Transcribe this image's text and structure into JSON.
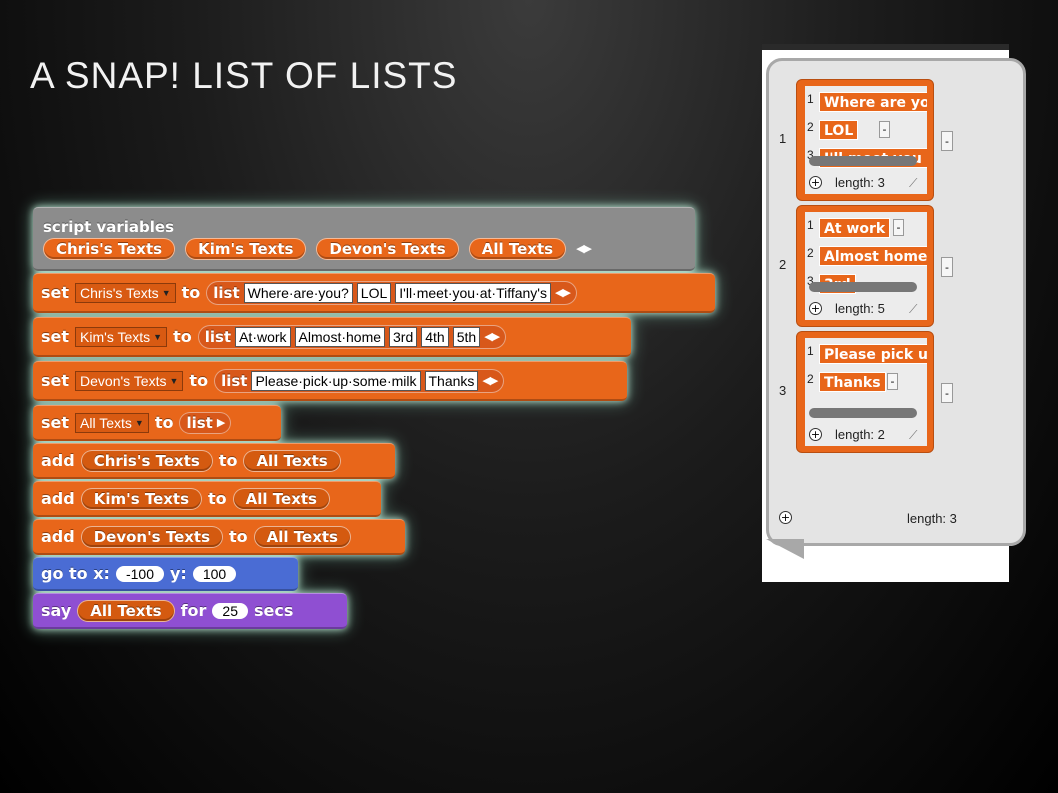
{
  "slide": {
    "title": "A SNAP! LIST OF LISTS"
  },
  "script": {
    "script_variables_label": "script variables",
    "variables": [
      "Chris's Texts",
      "Kim's Texts",
      "Devon's Texts",
      "All Texts"
    ],
    "set_kw": "set",
    "to_kw": "to",
    "list_kw": "list",
    "add_kw": "add",
    "set_blocks": [
      {
        "var": "Chris's Texts",
        "items": [
          "Where·are·you?",
          "LOL",
          "I'll·meet·you·at·Tiffany's"
        ]
      },
      {
        "var": "Kim's Texts",
        "items": [
          "At·work",
          "Almost·home",
          "3rd",
          "4th",
          "5th"
        ]
      },
      {
        "var": "Devon's Texts",
        "items": [
          "Please·pick·up·some·milk",
          "Thanks"
        ]
      },
      {
        "var": "All Texts",
        "items": []
      }
    ],
    "add_blocks": [
      {
        "item": "Chris's Texts",
        "target": "All Texts"
      },
      {
        "item": "Kim's Texts",
        "target": "All Texts"
      },
      {
        "item": "Devon's Texts",
        "target": "All Texts"
      }
    ],
    "goto": {
      "label": "go to x:",
      "x": "-100",
      "y_label": "y:",
      "y": "100"
    },
    "say": {
      "label": "say",
      "var": "All Texts",
      "for_kw": "for",
      "secs": "25",
      "secs_kw": "secs"
    }
  },
  "watcher": {
    "outer_length": "length: 3",
    "rows": [
      {
        "index": "1",
        "cells": [
          "Where are yo",
          "LOL",
          "I'll meet you a"
        ],
        "cell_indices": [
          "1",
          "2",
          "3"
        ],
        "length": "length: 3"
      },
      {
        "index": "2",
        "cells": [
          "At work",
          "Almost home",
          "3rd"
        ],
        "cell_indices": [
          "1",
          "2",
          "3"
        ],
        "length": "length: 5"
      },
      {
        "index": "3",
        "cells": [
          "Please pick u",
          "Thanks"
        ],
        "cell_indices": [
          "1",
          "2"
        ],
        "length": "length: 2"
      }
    ]
  },
  "colors": {
    "orange": "#e8661a",
    "gray": "#8c8c8c",
    "blue": "#4a6cd4",
    "purple": "#8f4fd2",
    "glow": "#c8f5e0"
  }
}
